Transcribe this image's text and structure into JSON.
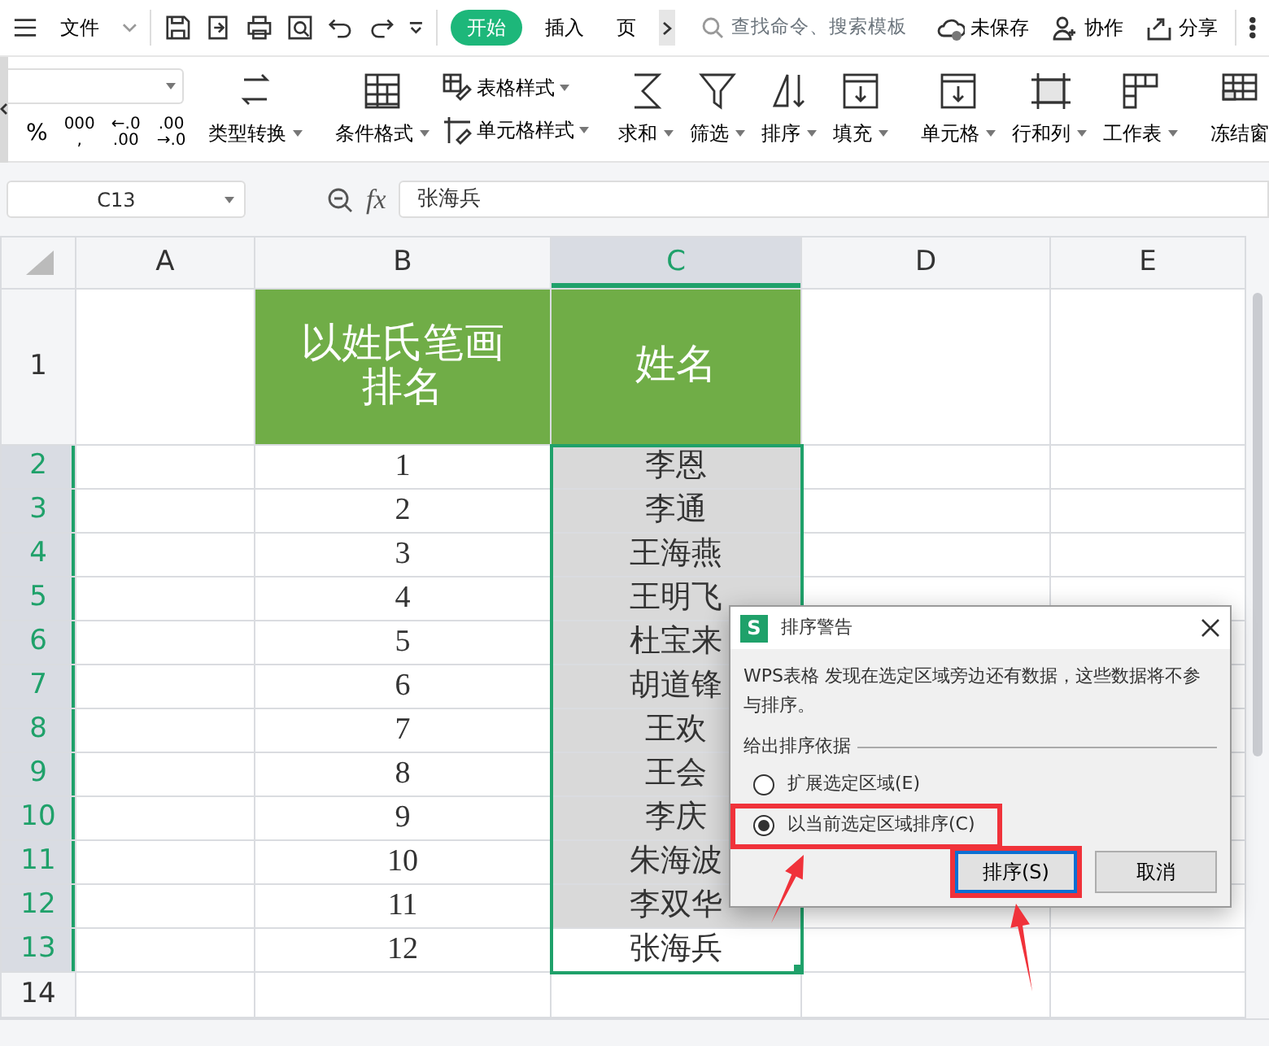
{
  "top_bar": {
    "menu_label": "文件",
    "tabs": [
      {
        "label": "开始",
        "selected": true
      },
      {
        "label": "插入",
        "selected": false
      },
      {
        "label": "页",
        "selected": false
      }
    ],
    "search": {
      "placeholder": "查找命令、搜索模板"
    },
    "actions": [
      "未保存",
      "协作",
      "分享"
    ]
  },
  "ribbon": {
    "number_buttons": [
      [
        "%"
      ],
      [
        "000",
        ","
      ],
      [
        "←.0",
        ".00"
      ],
      [
        ".00",
        "→.0"
      ]
    ],
    "groups": [
      [
        {
          "kind": "large",
          "label": "类型转换"
        }
      ],
      [
        {
          "kind": "large",
          "label": "条件格式"
        },
        {
          "kind": "stack",
          "items": [
            "表格样式",
            "单元格样式"
          ]
        }
      ],
      [
        {
          "kind": "large",
          "label": "求和"
        },
        {
          "kind": "large",
          "label": "筛选"
        },
        {
          "kind": "large",
          "label": "排序"
        },
        {
          "kind": "large",
          "label": "填充"
        }
      ],
      [
        {
          "kind": "large",
          "label": "单元格"
        },
        {
          "kind": "large",
          "label": "行和列"
        },
        {
          "kind": "large",
          "label": "工作表"
        }
      ],
      [
        {
          "kind": "large",
          "label": "冻结窗"
        }
      ]
    ]
  },
  "formula_bar": {
    "cell_ref": "C13",
    "fx_label": "fx",
    "value": "张海兵"
  },
  "sheet": {
    "columns": [
      {
        "label": "A",
        "selected": false
      },
      {
        "label": "B",
        "selected": false
      },
      {
        "label": "C",
        "selected": true
      },
      {
        "label": "D",
        "selected": false
      },
      {
        "label": "E",
        "selected": false
      }
    ],
    "rows": [
      {
        "num": "1",
        "kind": "title",
        "selected": false,
        "active": false,
        "rank": "以姓氏笔画排名",
        "name": "姓名"
      },
      {
        "num": "2",
        "kind": "data",
        "selected": true,
        "active": false,
        "rank": "1",
        "name": "李恩"
      },
      {
        "num": "3",
        "kind": "data",
        "selected": true,
        "active": false,
        "rank": "2",
        "name": "李通"
      },
      {
        "num": "4",
        "kind": "data",
        "selected": true,
        "active": false,
        "rank": "3",
        "name": "王海燕"
      },
      {
        "num": "5",
        "kind": "data",
        "selected": true,
        "active": false,
        "rank": "4",
        "name": "王明飞"
      },
      {
        "num": "6",
        "kind": "data",
        "selected": true,
        "active": false,
        "rank": "5",
        "name": "杜宝来"
      },
      {
        "num": "7",
        "kind": "data",
        "selected": true,
        "active": false,
        "rank": "6",
        "name": "胡道锋"
      },
      {
        "num": "8",
        "kind": "data",
        "selected": true,
        "active": false,
        "rank": "7",
        "name": "王欢"
      },
      {
        "num": "9",
        "kind": "data",
        "selected": true,
        "active": false,
        "rank": "8",
        "name": "王会"
      },
      {
        "num": "10",
        "kind": "data",
        "selected": true,
        "active": false,
        "rank": "9",
        "name": "李庆"
      },
      {
        "num": "11",
        "kind": "data",
        "selected": true,
        "active": false,
        "rank": "10",
        "name": "朱海波"
      },
      {
        "num": "12",
        "kind": "data",
        "selected": true,
        "active": false,
        "rank": "11",
        "name": "李双华"
      },
      {
        "num": "13",
        "kind": "data",
        "selected": true,
        "active": true,
        "rank": "12",
        "name": "张海兵"
      },
      {
        "num": "14",
        "kind": "empty",
        "selected": false,
        "active": false
      }
    ]
  },
  "dialog": {
    "icon_text": "S",
    "title": "排序警告",
    "message": "WPS表格 发现在选定区域旁边还有数据，这些数据将不参与排序。",
    "group_label": "给出排序依据",
    "options": [
      {
        "label": "扩展选定区域(E)",
        "selected": false,
        "highlighted": false
      },
      {
        "label": "以当前选定区域排序(C)",
        "selected": true,
        "highlighted": true
      }
    ],
    "buttons": [
      {
        "label": "排序(S)",
        "kind": "primary",
        "highlighted": true
      },
      {
        "label": "取消",
        "kind": "secondary",
        "highlighted": false
      }
    ]
  }
}
